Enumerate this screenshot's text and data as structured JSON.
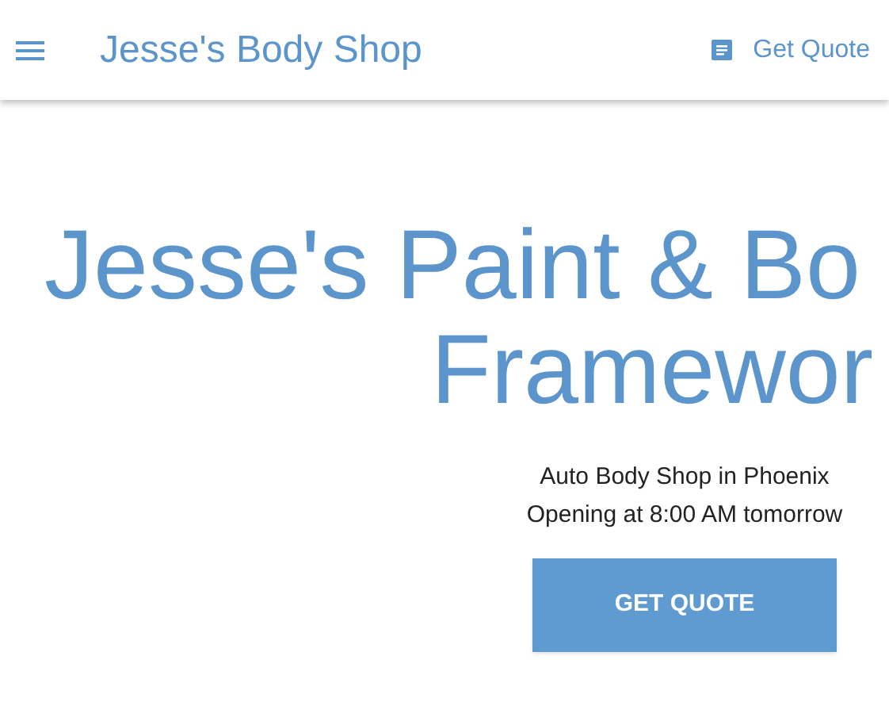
{
  "app_bar": {
    "title": "Jesse's Body Shop",
    "action": "Get Quote"
  },
  "hero": {
    "title_lines": [
      "Jesse's Paint & Bo",
      "Framewor"
    ],
    "subtitle_lines": [
      "Auto Body Shop in Phoenix",
      "Opening at 8:00 AM tomorrow"
    ],
    "button": "GET QUOTE"
  }
}
